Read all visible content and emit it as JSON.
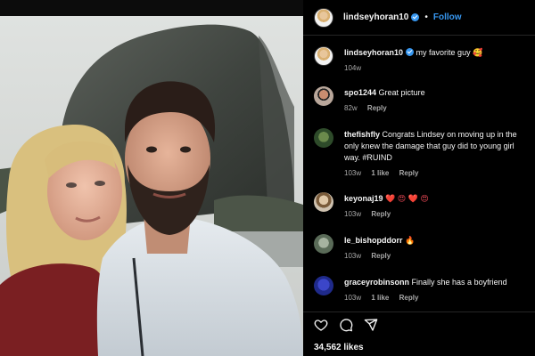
{
  "post": {
    "username": "lindseyhoran10",
    "dot": "•",
    "follow_label": "Follow"
  },
  "caption": {
    "username": "lindseyhoran10",
    "text": "my favorite guy 🥰",
    "time": "104w"
  },
  "comments": [
    {
      "username": "spo1244",
      "text": "Great picture",
      "time": "82w",
      "likes": "",
      "reply": "Reply"
    },
    {
      "username": "thefishfly",
      "text": "Congrats Lindsey on moving up in the",
      "text2": "only knew the damage that guy did to young girl",
      "text3": "way. #RUIND",
      "time": "103w",
      "likes": "1 like",
      "reply": "Reply"
    },
    {
      "username": "keyonaj19",
      "text": "❤️ 😍 ❤️ 😍",
      "time": "103w",
      "likes": "",
      "reply": "Reply"
    },
    {
      "username": "le_bishopddorr",
      "text": "🔥",
      "time": "103w",
      "likes": "",
      "reply": "Reply"
    },
    {
      "username": "graceyrobinsonn",
      "text": "Finally she has a boyfriend",
      "time": "103w",
      "likes": "1 like",
      "reply": "Reply"
    }
  ],
  "actions": {
    "likes_count": "34,562 likes",
    "icons": [
      "heart-icon",
      "comment-icon",
      "share-icon"
    ]
  },
  "colors": {
    "accent": "#3797f0",
    "background": "#000000",
    "muted": "#a8a8a8"
  }
}
